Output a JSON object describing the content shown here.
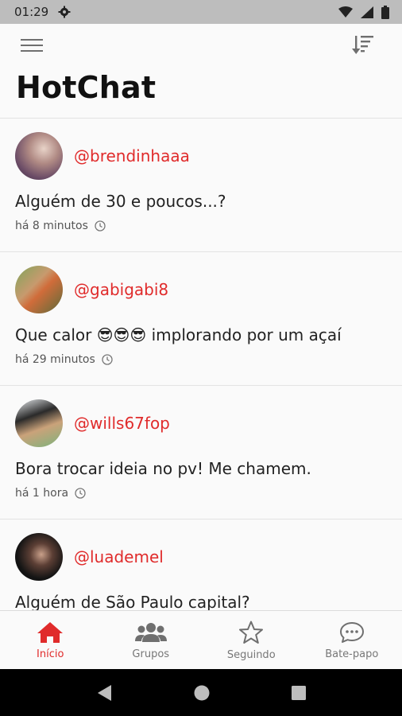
{
  "status_bar": {
    "time": "01:29",
    "icons": [
      "settings-icon",
      "wifi-icon",
      "signal-icon",
      "battery-icon"
    ]
  },
  "header": {
    "title": "HotChat",
    "icons": [
      "menu-icon",
      "sort-icon"
    ]
  },
  "posts": [
    {
      "username": "@brendinhaaa",
      "message": "Alguém de 30 e poucos...?",
      "time": "há 8 minutos"
    },
    {
      "username": "@gabigabi8",
      "message": "Que calor 😎😎😎 implorando por um açaí",
      "time": "há 29 minutos"
    },
    {
      "username": "@wills67fop",
      "message": "Bora trocar ideia no pv! Me chamem.",
      "time": "há 1 hora"
    },
    {
      "username": "@luademel",
      "message": "Alguém de São Paulo capital?",
      "time": ""
    }
  ],
  "nav": {
    "items": [
      {
        "label": "Início",
        "icon": "home-icon",
        "active": true
      },
      {
        "label": "Grupos",
        "icon": "groups-icon",
        "active": false
      },
      {
        "label": "Seguindo",
        "icon": "star-icon",
        "active": false
      },
      {
        "label": "Bate-papo",
        "icon": "chat-icon",
        "active": false
      }
    ]
  },
  "colors": {
    "accent": "#e02b2b",
    "background": "#fafafa",
    "status_bar": "#bdbdbd",
    "nav_bar": "#000000"
  }
}
